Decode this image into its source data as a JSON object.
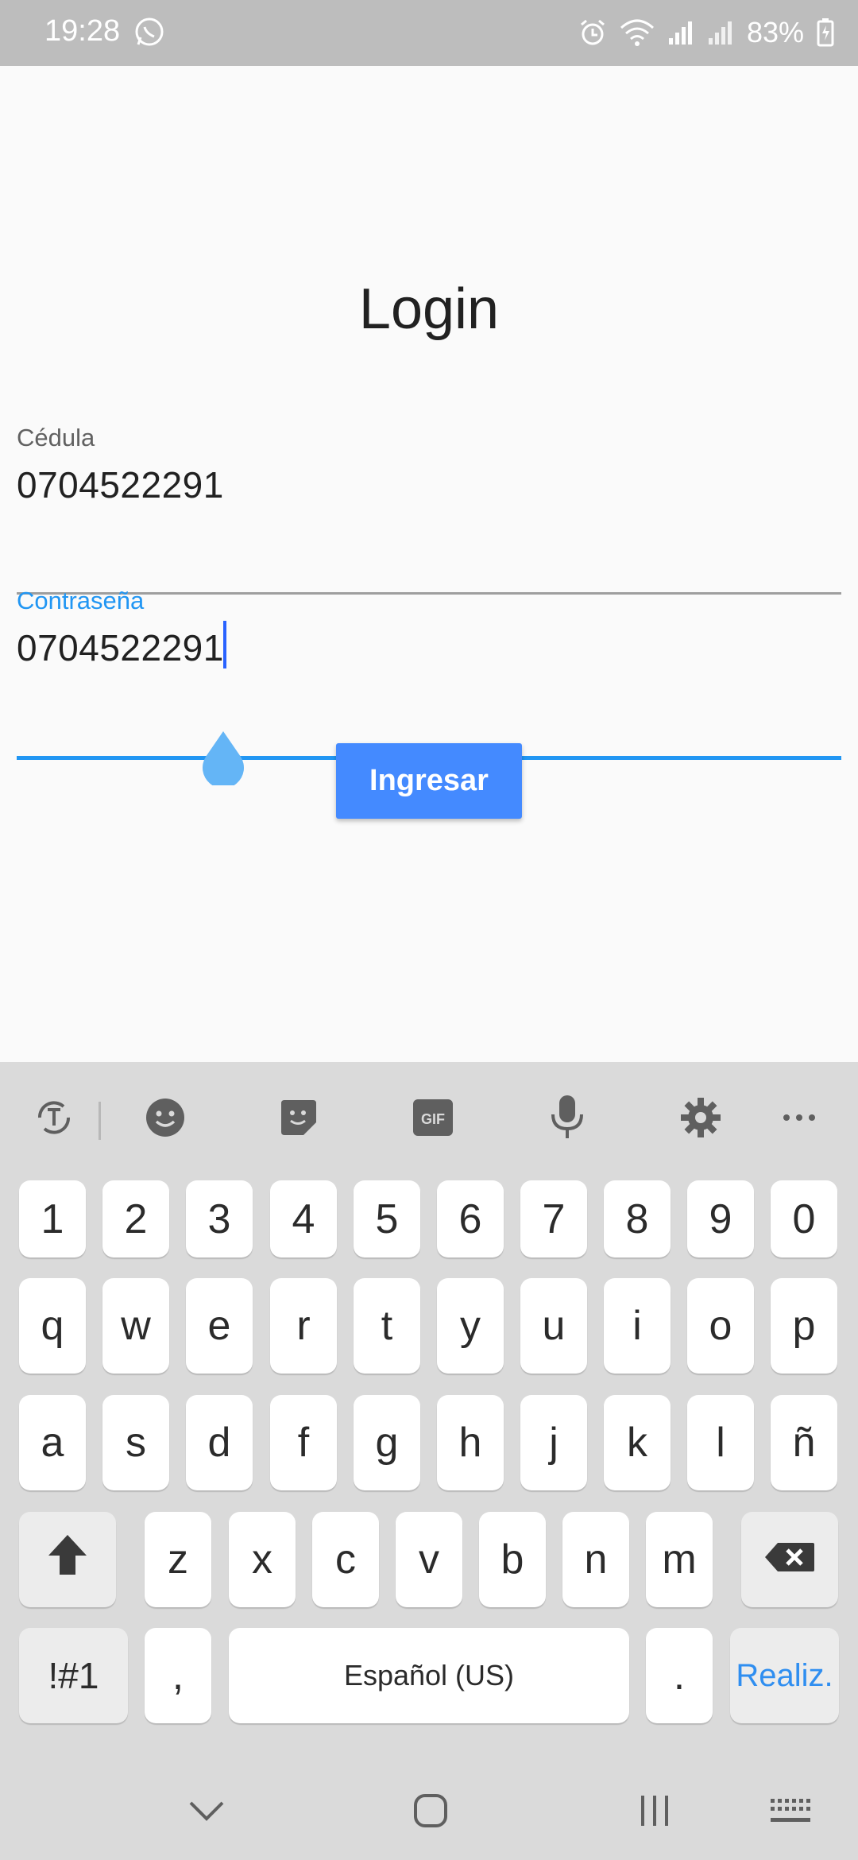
{
  "status_bar": {
    "time": "19:28",
    "battery": "83%",
    "icons": [
      "whatsapp-icon",
      "alarm-icon",
      "wifi-icon",
      "signal-icon",
      "signal-icon-2",
      "battery-charging-icon"
    ]
  },
  "login": {
    "title": "Login",
    "cedula_label": "Cédula",
    "cedula_value": "0704522291",
    "password_label": "Contraseña",
    "password_value": "0704522291",
    "submit_label": "Ingresar"
  },
  "colors": {
    "accent": "#2196f3",
    "button": "#448aff",
    "keyboard_bg": "#dadada"
  },
  "keyboard": {
    "toolbar": [
      "translate-icon",
      "emoji-icon",
      "sticker-icon",
      "gif-icon",
      "microphone-icon",
      "settings-icon",
      "more-icon"
    ],
    "row_numbers": [
      "1",
      "2",
      "3",
      "4",
      "5",
      "6",
      "7",
      "8",
      "9",
      "0"
    ],
    "row1": [
      "q",
      "w",
      "e",
      "r",
      "t",
      "y",
      "u",
      "i",
      "o",
      "p"
    ],
    "row2": [
      "a",
      "s",
      "d",
      "f",
      "g",
      "h",
      "j",
      "k",
      "l",
      "ñ"
    ],
    "row3": [
      "z",
      "x",
      "c",
      "v",
      "b",
      "n",
      "m"
    ],
    "symbols_label": "!#1",
    "comma_label": ",",
    "space_label": "Español (US)",
    "period_label": ".",
    "done_label": "Realiz."
  },
  "nav_bar": {
    "icons": [
      "hide-keyboard-icon",
      "home-icon",
      "recents-icon",
      "keyboard-switch-icon"
    ]
  }
}
